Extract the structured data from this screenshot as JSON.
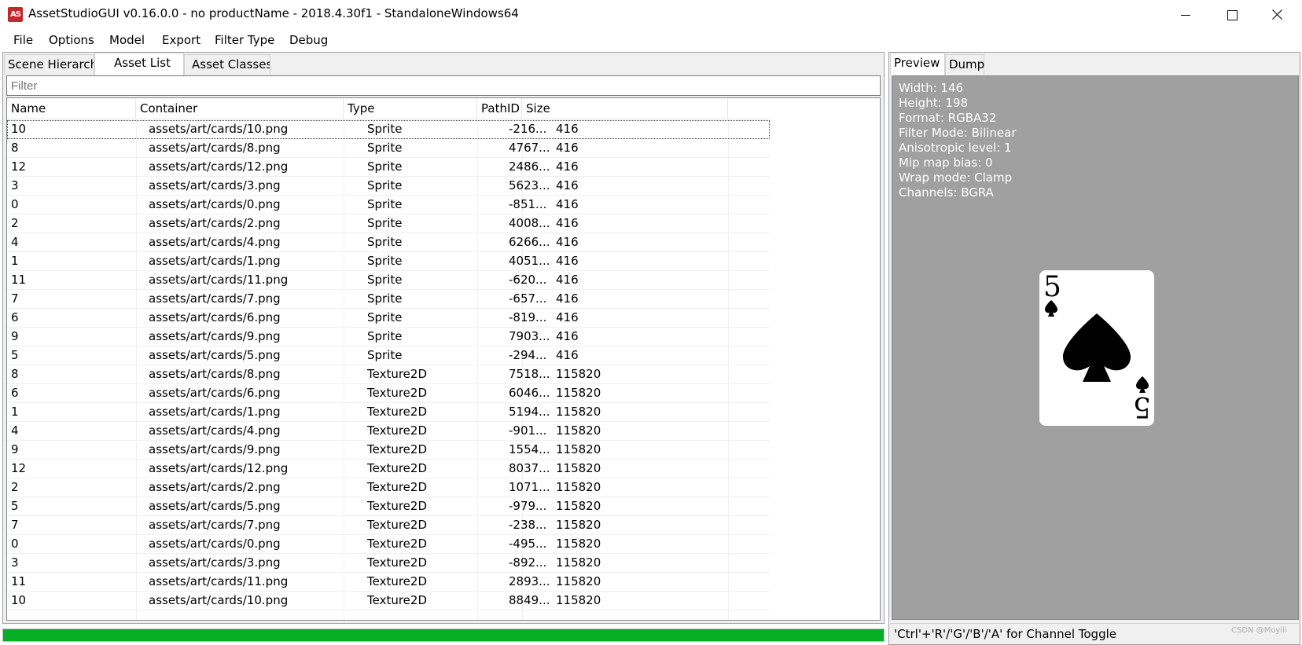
{
  "window": {
    "title": "AssetStudioGUI v0.16.0.0 - no productName - 2018.4.30f1 - StandaloneWindows64",
    "icon_text": "AS"
  },
  "menu": [
    "File",
    "Options",
    "Model",
    "Export",
    "Filter Type",
    "Debug"
  ],
  "left_tabs": [
    "Scene Hierarchy",
    "Asset List",
    "Asset Classes"
  ],
  "filter": {
    "placeholder": "Filter"
  },
  "columns": [
    "Name",
    "Container",
    "Type",
    "PathID",
    "Size"
  ],
  "rows": [
    [
      "10",
      "assets/art/cards/10.png",
      "Sprite",
      "-216...",
      "416"
    ],
    [
      "8",
      "assets/art/cards/8.png",
      "Sprite",
      "4767...",
      "416"
    ],
    [
      "12",
      "assets/art/cards/12.png",
      "Sprite",
      "2486...",
      "416"
    ],
    [
      "3",
      "assets/art/cards/3.png",
      "Sprite",
      "5623...",
      "416"
    ],
    [
      "0",
      "assets/art/cards/0.png",
      "Sprite",
      "-851...",
      "416"
    ],
    [
      "2",
      "assets/art/cards/2.png",
      "Sprite",
      "4008...",
      "416"
    ],
    [
      "4",
      "assets/art/cards/4.png",
      "Sprite",
      "6266...",
      "416"
    ],
    [
      "1",
      "assets/art/cards/1.png",
      "Sprite",
      "4051...",
      "416"
    ],
    [
      "11",
      "assets/art/cards/11.png",
      "Sprite",
      "-620...",
      "416"
    ],
    [
      "7",
      "assets/art/cards/7.png",
      "Sprite",
      "-657...",
      "416"
    ],
    [
      "6",
      "assets/art/cards/6.png",
      "Sprite",
      "-819...",
      "416"
    ],
    [
      "9",
      "assets/art/cards/9.png",
      "Sprite",
      "7903...",
      "416"
    ],
    [
      "5",
      "assets/art/cards/5.png",
      "Sprite",
      "-294...",
      "416"
    ],
    [
      "8",
      "assets/art/cards/8.png",
      "Texture2D",
      "7518...",
      "115820"
    ],
    [
      "6",
      "assets/art/cards/6.png",
      "Texture2D",
      "6046...",
      "115820"
    ],
    [
      "1",
      "assets/art/cards/1.png",
      "Texture2D",
      "5194...",
      "115820"
    ],
    [
      "4",
      "assets/art/cards/4.png",
      "Texture2D",
      "-901...",
      "115820"
    ],
    [
      "9",
      "assets/art/cards/9.png",
      "Texture2D",
      "1554...",
      "115820"
    ],
    [
      "12",
      "assets/art/cards/12.png",
      "Texture2D",
      "8037...",
      "115820"
    ],
    [
      "2",
      "assets/art/cards/2.png",
      "Texture2D",
      "1071...",
      "115820"
    ],
    [
      "5",
      "assets/art/cards/5.png",
      "Texture2D",
      "-979...",
      "115820"
    ],
    [
      "7",
      "assets/art/cards/7.png",
      "Texture2D",
      "-238...",
      "115820"
    ],
    [
      "0",
      "assets/art/cards/0.png",
      "Texture2D",
      "-495...",
      "115820"
    ],
    [
      "3",
      "assets/art/cards/3.png",
      "Texture2D",
      "-892...",
      "115820"
    ],
    [
      "11",
      "assets/art/cards/11.png",
      "Texture2D",
      "2893...",
      "115820"
    ],
    [
      "10",
      "assets/art/cards/10.png",
      "Texture2D",
      "8849...",
      "115820"
    ]
  ],
  "selected_row": 0,
  "progress": {
    "fraction": 1.0,
    "color": "#06b025"
  },
  "right_tabs": [
    "Preview",
    "Dump"
  ],
  "texture_info": [
    "Width: 146",
    "Height: 198",
    "Format: RGBA32",
    "Filter Mode: Bilinear",
    "Anisotropic level: 1",
    "Mip map bias: 0",
    "Wrap mode: Clamp",
    "Channels: BGRA"
  ],
  "card": {
    "rank": "5",
    "suit": "spade-icon"
  },
  "status_text": "'Ctrl'+'R'/'G'/'B'/'A' for Channel Toggle",
  "watermark": "CSDN @Moyiii"
}
